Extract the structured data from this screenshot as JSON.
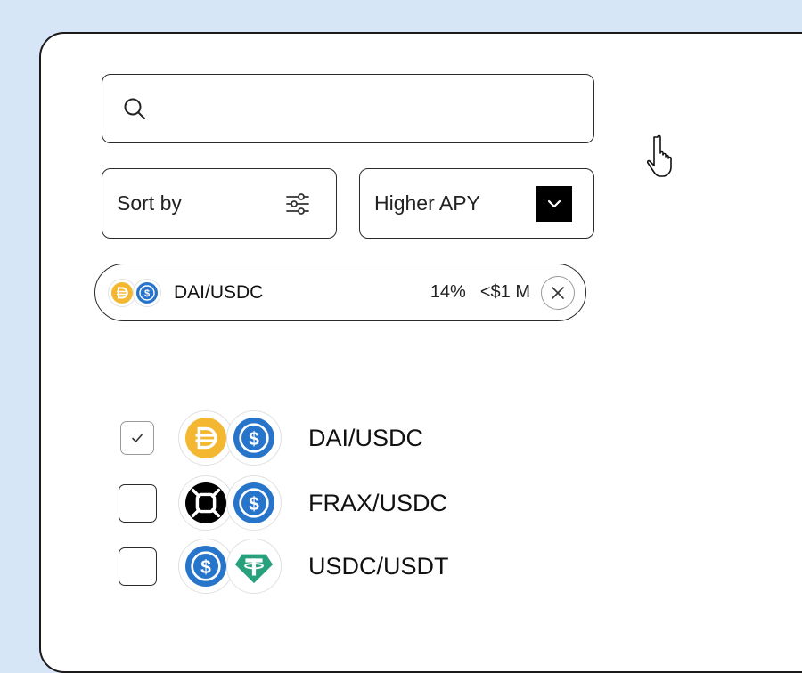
{
  "search": {
    "placeholder": "",
    "value": "",
    "icon": "search-icon"
  },
  "filters": {
    "sort_label": "Sort by",
    "sort_icon": "sliders-icon",
    "order_label": "Higher APY",
    "order_icon": "chevron-down-icon"
  },
  "selected_chip": {
    "pair": "DAI/USDC",
    "apy": "14%",
    "tvl": "<$1 M",
    "coins": [
      "dai-icon",
      "usdc-icon"
    ],
    "close_icon": "close-icon"
  },
  "pools": [
    {
      "pair": "DAI/USDC",
      "checked": true,
      "coins": [
        "dai-icon",
        "usdc-icon"
      ]
    },
    {
      "pair": "FRAX/USDC",
      "checked": false,
      "coins": [
        "frax-icon",
        "usdc-icon"
      ]
    },
    {
      "pair": "USDC/USDT",
      "checked": false,
      "coins": [
        "usdc-icon",
        "usdt-icon"
      ]
    }
  ],
  "colors": {
    "background": "#d6e6f7",
    "dai": "#f4b731",
    "usdc": "#2775ca",
    "usdt": "#26a17b",
    "frax": "#000000"
  }
}
